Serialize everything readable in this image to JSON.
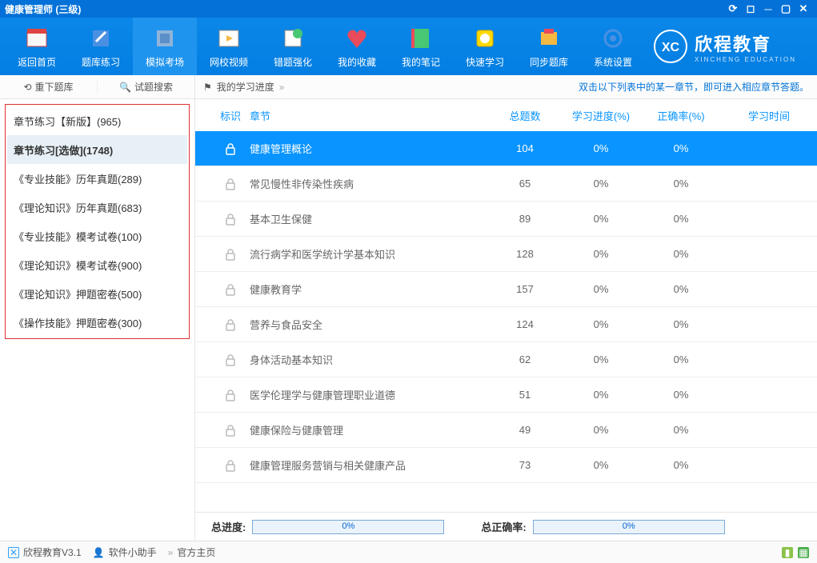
{
  "title": "健康管理师 (三级)",
  "toolbar": [
    {
      "id": "home",
      "label": "返回首页"
    },
    {
      "id": "practice",
      "label": "题库练习"
    },
    {
      "id": "exam",
      "label": "模拟考场",
      "active": true
    },
    {
      "id": "video",
      "label": "网校视频"
    },
    {
      "id": "wrong",
      "label": "错题强化"
    },
    {
      "id": "fav",
      "label": "我的收藏"
    },
    {
      "id": "notes",
      "label": "我的笔记"
    },
    {
      "id": "fast",
      "label": "快速学习"
    },
    {
      "id": "sync",
      "label": "同步题库"
    },
    {
      "id": "settings",
      "label": "系统设置"
    }
  ],
  "brand": {
    "cn": "欣程教育",
    "en": "XINCHENG EDUCATION"
  },
  "side_actions": {
    "redownload": "重下题库",
    "search": "试题搜索"
  },
  "sidebar": [
    {
      "label": "章节练习【新版】(965)"
    },
    {
      "label": "章节练习[选做](1748)",
      "active": true
    },
    {
      "label": "《专业技能》历年真题(289)"
    },
    {
      "label": "《理论知识》历年真题(683)"
    },
    {
      "label": "《专业技能》模考试卷(100)"
    },
    {
      "label": "《理论知识》模考试卷(900)"
    },
    {
      "label": "《理论知识》押题密卷(500)"
    },
    {
      "label": "《操作技能》押题密卷(300)"
    }
  ],
  "subtop": {
    "progress": "我的学习进度",
    "hint": "双击以下列表中的某一章节，即可进入相应章节答题。"
  },
  "columns": {
    "mark": "标识",
    "chapter": "章节",
    "total": "总题数",
    "progress": "学习进度(%)",
    "accuracy": "正确率(%)",
    "time": "学习时间"
  },
  "rows": [
    {
      "chapter": "健康管理概论",
      "total": 104,
      "progress": "0%",
      "accuracy": "0%",
      "selected": true
    },
    {
      "chapter": "常见慢性非传染性疾病",
      "total": 65,
      "progress": "0%",
      "accuracy": "0%"
    },
    {
      "chapter": "基本卫生保健",
      "total": 89,
      "progress": "0%",
      "accuracy": "0%"
    },
    {
      "chapter": "流行病学和医学统计学基本知识",
      "total": 128,
      "progress": "0%",
      "accuracy": "0%"
    },
    {
      "chapter": "健康教育学",
      "total": 157,
      "progress": "0%",
      "accuracy": "0%"
    },
    {
      "chapter": "营养与食品安全",
      "total": 124,
      "progress": "0%",
      "accuracy": "0%"
    },
    {
      "chapter": "身体活动基本知识",
      "total": 62,
      "progress": "0%",
      "accuracy": "0%"
    },
    {
      "chapter": "医学伦理学与健康管理职业道德",
      "total": 51,
      "progress": "0%",
      "accuracy": "0%"
    },
    {
      "chapter": "健康保险与健康管理",
      "total": 49,
      "progress": "0%",
      "accuracy": "0%"
    },
    {
      "chapter": "健康管理服务营销与相关健康产品",
      "total": 73,
      "progress": "0%",
      "accuracy": "0%"
    }
  ],
  "summary": {
    "total_label": "总进度:",
    "total_val": "0%",
    "acc_label": "总正确率:",
    "acc_val": "0%"
  },
  "status": {
    "version": "欣程教育V3.1",
    "helper": "软件小助手",
    "official": "官方主页"
  }
}
